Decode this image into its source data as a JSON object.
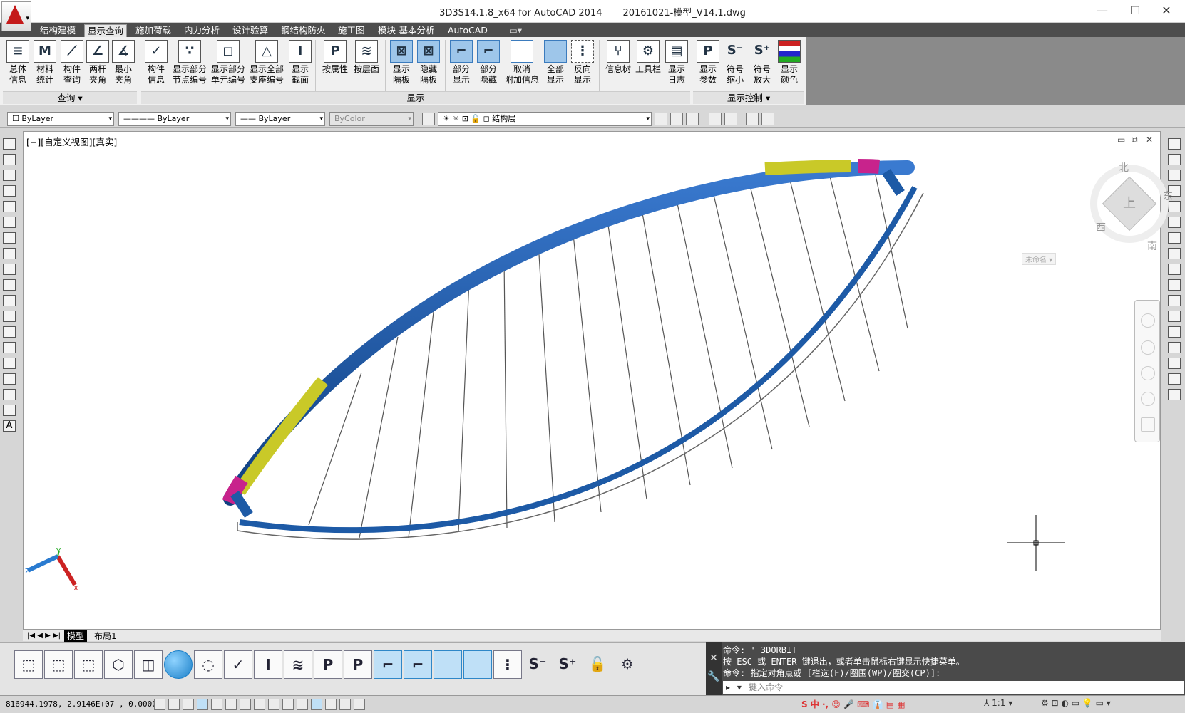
{
  "window": {
    "title": "3D3S14.1.8_x64 for AutoCAD 2014",
    "document": "20161021-模型_V14.1.dwg"
  },
  "tabs": [
    "结构建模",
    "显示查询",
    "施加荷载",
    "内力分析",
    "设计验算",
    "钢结构防火",
    "施工图",
    "模块-基本分析",
    "AutoCAD"
  ],
  "active_tab": "显示查询",
  "ribbon": {
    "query": {
      "label": "查询",
      "buttons": [
        {
          "l1": "总体",
          "l2": "信息",
          "icon": "overall-info-icon"
        },
        {
          "l1": "材料",
          "l2": "统计",
          "icon": "material-stats-icon"
        },
        {
          "l1": "构件",
          "l2": "查询",
          "icon": "member-query-icon"
        },
        {
          "l1": "两杆",
          "l2": "夹角",
          "icon": "two-bar-angle-icon"
        },
        {
          "l1": "最小",
          "l2": "夹角",
          "icon": "min-angle-icon"
        }
      ]
    },
    "display": {
      "label": "显示",
      "buttons": [
        {
          "l1": "构件",
          "l2": "信息",
          "icon": "member-info-icon"
        },
        {
          "l1": "显示部分",
          "l2": "节点编号",
          "icon": "node-number-icon"
        },
        {
          "l1": "显示部分",
          "l2": "单元编号",
          "icon": "element-number-icon"
        },
        {
          "l1": "显示全部",
          "l2": "支座编号",
          "icon": "support-number-icon"
        },
        {
          "l1": "显示",
          "l2": "截面",
          "icon": "section-icon"
        },
        {
          "l1": "按属性",
          "l2": "",
          "icon": "by-property-icon"
        },
        {
          "l1": "按层面",
          "l2": "",
          "icon": "by-layer-icon"
        },
        {
          "l1": "显示",
          "l2": "隔板",
          "icon": "show-diaphragm-icon"
        },
        {
          "l1": "隐藏",
          "l2": "隔板",
          "icon": "hide-diaphragm-icon"
        },
        {
          "l1": "部分",
          "l2": "显示",
          "icon": "partial-show-icon"
        },
        {
          "l1": "部分",
          "l2": "隐藏",
          "icon": "partial-hide-icon"
        },
        {
          "l1": "取消",
          "l2": "附加信息",
          "icon": "cancel-extra-icon"
        },
        {
          "l1": "全部",
          "l2": "显示",
          "icon": "show-all-icon"
        },
        {
          "l1": "反向",
          "l2": "显示",
          "icon": "reverse-show-icon"
        },
        {
          "l1": "信息树",
          "l2": "",
          "icon": "info-tree-icon"
        },
        {
          "l1": "工具栏",
          "l2": "",
          "icon": "gear-icon"
        },
        {
          "l1": "显示",
          "l2": "日志",
          "icon": "log-icon"
        }
      ]
    },
    "display_control": {
      "label": "显示控制",
      "buttons": [
        {
          "l1": "显示",
          "l2": "参数",
          "icon": "params-icon"
        },
        {
          "l1": "符号",
          "l2": "缩小",
          "icon": "symbol-shrink-icon"
        },
        {
          "l1": "符号",
          "l2": "放大",
          "icon": "symbol-enlarge-icon"
        },
        {
          "l1": "显示",
          "l2": "颜色",
          "icon": "color-icon"
        }
      ]
    }
  },
  "properties": {
    "color": "ByLayer",
    "linetype": "ByLayer",
    "lineweight": "ByLayer",
    "plotstyle": "ByColor",
    "layer": "结构层"
  },
  "viewport": {
    "label": "[−][自定义视图][真实]",
    "viewcube": {
      "north": "北",
      "south": "南",
      "east": "东",
      "west": "西",
      "face": "上",
      "ucs": "未命名"
    }
  },
  "layout_tabs": [
    "模型",
    "布局1"
  ],
  "command": {
    "lines": [
      "命令: '_3DORBIT",
      "按 ESC 或 ENTER 键退出，或者单击鼠标右键显示快捷菜单。",
      "命令: 指定对角点或 [栏选(F)/圈围(WP)/圈交(CP)]:"
    ],
    "placeholder": "键入命令"
  },
  "status": {
    "coords": "816944.1978, 2.9146E+07 , 0.0000",
    "scale": "1:1"
  },
  "colors": {
    "arch_blue": "#1d5aa6",
    "arch_yellow": "#c9c928",
    "arch_magenta": "#c8238c",
    "tab_dark": "#4d4d4d"
  }
}
